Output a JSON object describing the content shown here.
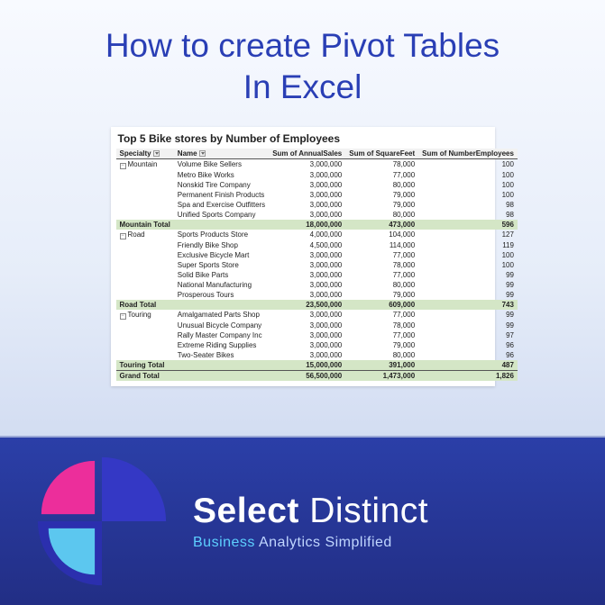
{
  "title": {
    "line1": "How to create Pivot Tables",
    "line2": "In Excel"
  },
  "pivot": {
    "title": "Top 5 Bike stores by Number of Employees",
    "columns": [
      "Specialty",
      "Name",
      "Sum of AnnualSales",
      "Sum of SquareFeet",
      "Sum of NumberEmployees"
    ],
    "groups": [
      {
        "specialty": "Mountain",
        "rows": [
          {
            "name": "Volume Bike Sellers",
            "sales": "3,000,000",
            "sqft": "78,000",
            "emp": "100"
          },
          {
            "name": "Metro Bike Works",
            "sales": "3,000,000",
            "sqft": "77,000",
            "emp": "100"
          },
          {
            "name": "Nonskid Tire Company",
            "sales": "3,000,000",
            "sqft": "80,000",
            "emp": "100"
          },
          {
            "name": "Permanent Finish Products",
            "sales": "3,000,000",
            "sqft": "79,000",
            "emp": "100"
          },
          {
            "name": "Spa and Exercise Outfitters",
            "sales": "3,000,000",
            "sqft": "79,000",
            "emp": "98"
          },
          {
            "name": "Unified Sports Company",
            "sales": "3,000,000",
            "sqft": "80,000",
            "emp": "98"
          }
        ],
        "subtotal": {
          "label": "Mountain Total",
          "sales": "18,000,000",
          "sqft": "473,000",
          "emp": "596"
        }
      },
      {
        "specialty": "Road",
        "rows": [
          {
            "name": "Sports Products Store",
            "sales": "4,000,000",
            "sqft": "104,000",
            "emp": "127"
          },
          {
            "name": "Friendly Bike Shop",
            "sales": "4,500,000",
            "sqft": "114,000",
            "emp": "119"
          },
          {
            "name": "Exclusive Bicycle Mart",
            "sales": "3,000,000",
            "sqft": "77,000",
            "emp": "100"
          },
          {
            "name": "Super Sports Store",
            "sales": "3,000,000",
            "sqft": "78,000",
            "emp": "100"
          },
          {
            "name": "Solid Bike Parts",
            "sales": "3,000,000",
            "sqft": "77,000",
            "emp": "99"
          },
          {
            "name": "National Manufacturing",
            "sales": "3,000,000",
            "sqft": "80,000",
            "emp": "99"
          },
          {
            "name": "Prosperous Tours",
            "sales": "3,000,000",
            "sqft": "79,000",
            "emp": "99"
          }
        ],
        "subtotal": {
          "label": "Road Total",
          "sales": "23,500,000",
          "sqft": "609,000",
          "emp": "743"
        }
      },
      {
        "specialty": "Touring",
        "rows": [
          {
            "name": "Amalgamated Parts Shop",
            "sales": "3,000,000",
            "sqft": "77,000",
            "emp": "99"
          },
          {
            "name": "Unusual Bicycle Company",
            "sales": "3,000,000",
            "sqft": "78,000",
            "emp": "99"
          },
          {
            "name": "Rally Master Company Inc",
            "sales": "3,000,000",
            "sqft": "77,000",
            "emp": "97"
          },
          {
            "name": "Extreme Riding Supplies",
            "sales": "3,000,000",
            "sqft": "79,000",
            "emp": "96"
          },
          {
            "name": "Two-Seater Bikes",
            "sales": "3,000,000",
            "sqft": "80,000",
            "emp": "96"
          }
        ],
        "subtotal": {
          "label": "Touring Total",
          "sales": "15,000,000",
          "sqft": "391,000",
          "emp": "487"
        }
      }
    ],
    "grand": {
      "label": "Grand Total",
      "sales": "56,500,000",
      "sqft": "1,473,000",
      "emp": "1,826"
    }
  },
  "brand": {
    "name_a": "Select ",
    "name_b": "Distinct",
    "tag_a": "Business ",
    "tag_b": "Analytics Simplified"
  }
}
